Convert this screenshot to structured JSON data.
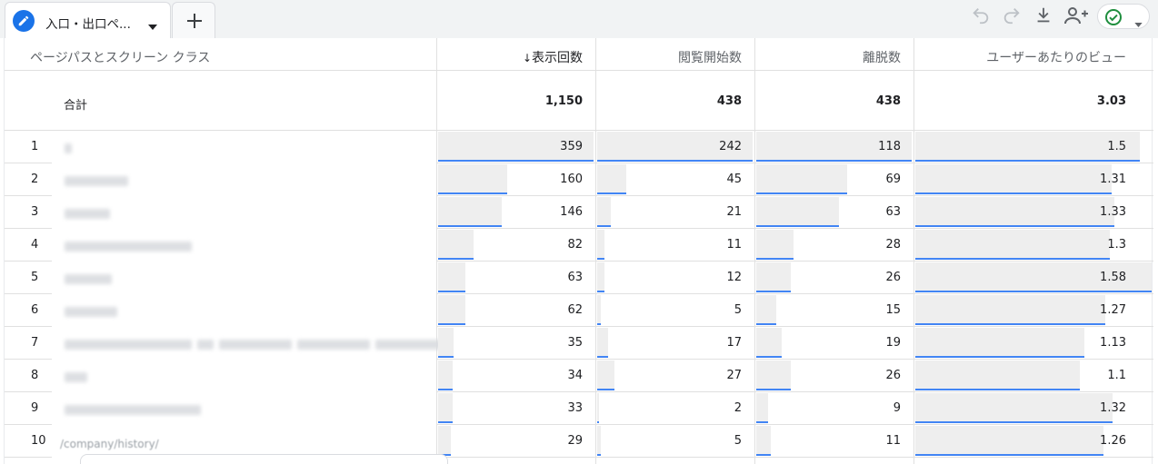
{
  "tab": {
    "label": "入口・出口ペ..."
  },
  "table": {
    "headers": {
      "dimension": "ページパスとスクリーン クラス",
      "sort_arrow": "↓",
      "m1": "表示回数",
      "m2": "閲覧開始数",
      "m3": "離脱数",
      "m4": "ユーザーあたりのビュー"
    },
    "total": {
      "label": "合計",
      "m1": "1,150",
      "m2": "438",
      "m3": "438",
      "m4": "3.03"
    },
    "rows": [
      {
        "idx": "1",
        "m1": "359",
        "m2": "242",
        "m3": "118",
        "m4": "1.5"
      },
      {
        "idx": "2",
        "m1": "160",
        "m2": "45",
        "m3": "69",
        "m4": "1.31"
      },
      {
        "idx": "3",
        "m1": "146",
        "m2": "21",
        "m3": "63",
        "m4": "1.33"
      },
      {
        "idx": "4",
        "m1": "82",
        "m2": "11",
        "m3": "28",
        "m4": "1.3"
      },
      {
        "idx": "5",
        "m1": "63",
        "m2": "12",
        "m3": "26",
        "m4": "1.58"
      },
      {
        "idx": "6",
        "m1": "62",
        "m2": "5",
        "m3": "15",
        "m4": "1.27"
      },
      {
        "idx": "7",
        "m1": "35",
        "m2": "17",
        "m3": "19",
        "m4": "1.13"
      },
      {
        "idx": "8",
        "m1": "34",
        "m2": "27",
        "m3": "26",
        "m4": "1.1"
      },
      {
        "idx": "9",
        "m1": "33",
        "m2": "2",
        "m3": "9",
        "m4": "1.32"
      },
      {
        "idx": "10",
        "m1": "29",
        "m2": "5",
        "m3": "11",
        "m4": "1.26"
      }
    ],
    "row10_partial_text": "/company/history/"
  },
  "colors": {
    "accent": "#1a73e8",
    "bar_fill": "#eeeeee",
    "bar_line": "#4285f4",
    "success": "#1e8e3e"
  },
  "icons": [
    "pencil-icon",
    "caret-down-icon",
    "plus-icon",
    "undo-icon",
    "redo-icon",
    "download-icon",
    "share-user-icon",
    "check-circle-icon"
  ]
}
